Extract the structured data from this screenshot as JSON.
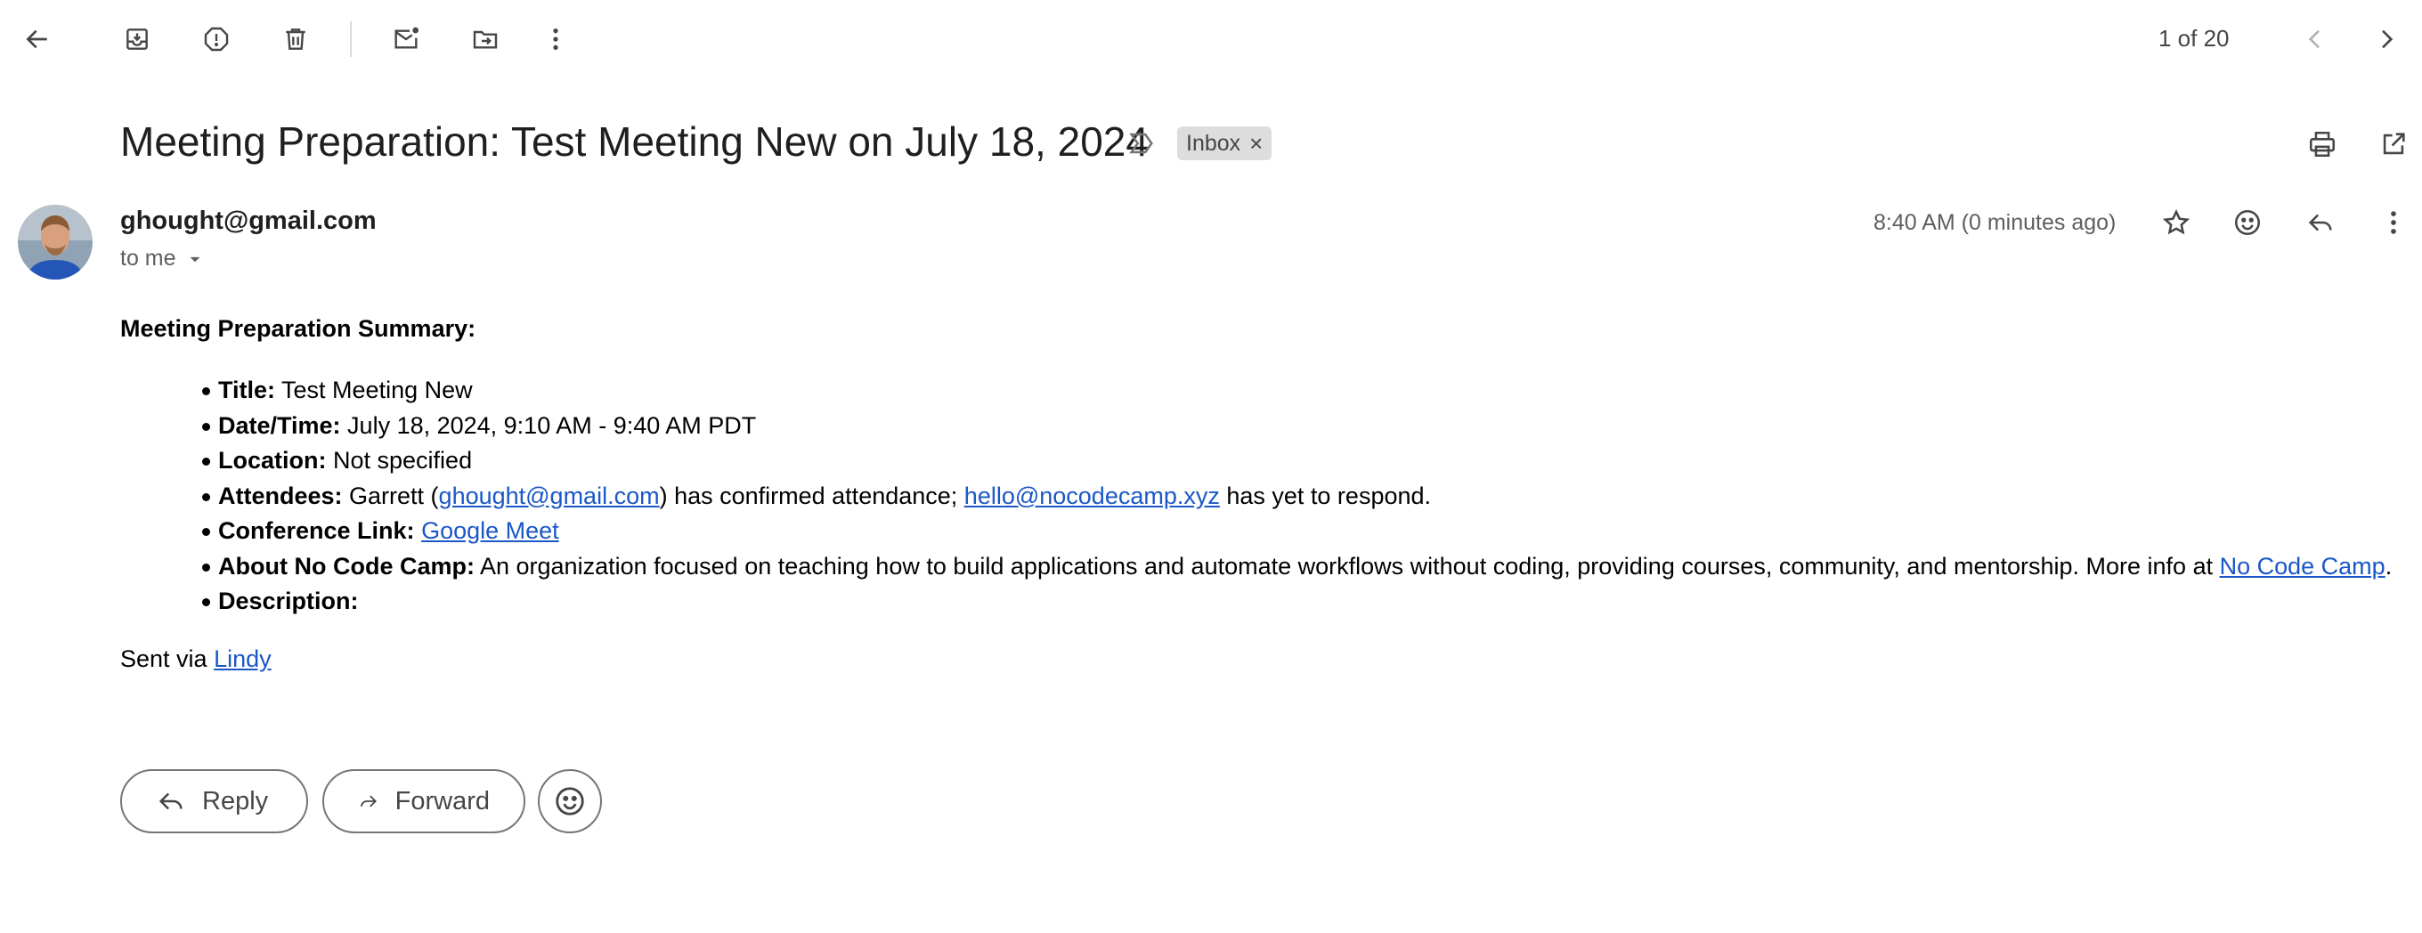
{
  "toolbar": {
    "back_icon": "arrow-left-icon",
    "archive_icon": "archive-icon",
    "spam_icon": "report-spam-icon",
    "delete_icon": "trash-icon",
    "mark_unread_icon": "mark-unread-icon",
    "move_icon": "move-to-folder-icon",
    "more_icon": "more-vertical-icon",
    "pager": "1 of 20",
    "prev_icon": "chevron-left-icon",
    "next_icon": "chevron-right-icon"
  },
  "message": {
    "subject": "Meeting Preparation: Test Meeting New on July 18, 2024",
    "label": "Inbox",
    "label_remove": "×",
    "sender_email": "ghought@gmail.com",
    "to": "to me",
    "timestamp": "8:40 AM (0 minutes ago)"
  },
  "body": {
    "summary_title": "Meeting Preparation Summary:",
    "items": [
      {
        "label": "Title:",
        "text": " Test Meeting New"
      },
      {
        "label": "Date/Time:",
        "text": " July 18, 2024, 9:10 AM - 9:40 AM PDT"
      },
      {
        "label": "Location:",
        "text": " Not specified"
      },
      {
        "label": "Attendees:",
        "pre": " Garrett (",
        "link1": "ghought@gmail.com",
        "mid": ") has confirmed attendance; ",
        "link2": "hello@nocodecamp.xyz",
        "post": " has yet to respond."
      },
      {
        "label": "Conference Link:",
        "pre": " ",
        "link1": "Google Meet"
      },
      {
        "label": "About No Code Camp:",
        "pre": " An organization focused on teaching how to build applications and automate workflows without coding, providing courses, community, and mentorship. More info at ",
        "link1": "No Code Camp",
        "post": "."
      },
      {
        "label": "Description:",
        "text": ""
      }
    ],
    "sent_via_prefix": "Sent via ",
    "sent_via_link": "Lindy"
  },
  "actions": {
    "reply": "Reply",
    "forward": "Forward"
  },
  "colors": {
    "link": "#1a57c7",
    "chip_bg": "#dddddd",
    "icon": "#444746"
  }
}
